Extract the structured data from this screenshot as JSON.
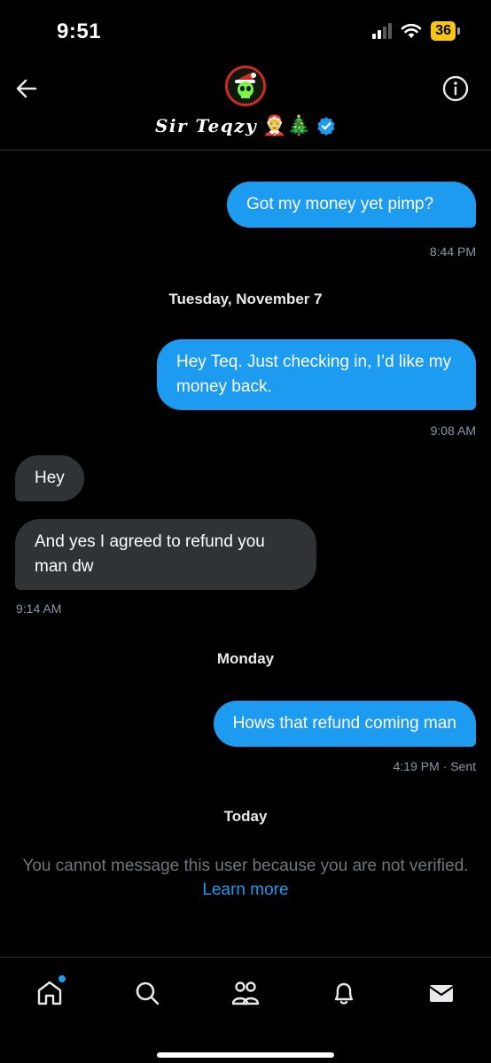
{
  "status_bar": {
    "time": "9:51",
    "battery": "36"
  },
  "header": {
    "contact_name": "Sir Teqzy",
    "name_emojis": "🤶🎄"
  },
  "messages": [
    {
      "direction": "out",
      "text": "Got my money yet pimp?",
      "time": "8:44 PM"
    },
    {
      "type": "date",
      "text": "Tuesday, November 7"
    },
    {
      "direction": "out",
      "text": "Hey Teq. Just checking in, I’d like my money back.",
      "time": "9:08 AM"
    },
    {
      "direction": "in",
      "text": "Hey"
    },
    {
      "direction": "in",
      "text": "And yes I agreed to refund you man dw",
      "time": "9:14 AM"
    },
    {
      "type": "date",
      "text": "Monday"
    },
    {
      "direction": "out",
      "text": "Hows that refund coming man",
      "time": "4:19 PM",
      "status": "· Sent"
    },
    {
      "type": "date",
      "text": "Today"
    }
  ],
  "notice": {
    "text": "You cannot message this user because you are not verified.",
    "link": "Learn more"
  },
  "tabs": [
    {
      "name": "home",
      "icon": "home-icon",
      "has_dot": true
    },
    {
      "name": "search",
      "icon": "search-icon"
    },
    {
      "name": "communities",
      "icon": "communities-icon"
    },
    {
      "name": "notifications",
      "icon": "bell-icon"
    },
    {
      "name": "messages",
      "icon": "mail-icon"
    }
  ],
  "colors": {
    "accent": "#1d9bf0",
    "incoming_bubble": "#2f3336",
    "muted_text": "#71767b",
    "background": "#000000"
  }
}
